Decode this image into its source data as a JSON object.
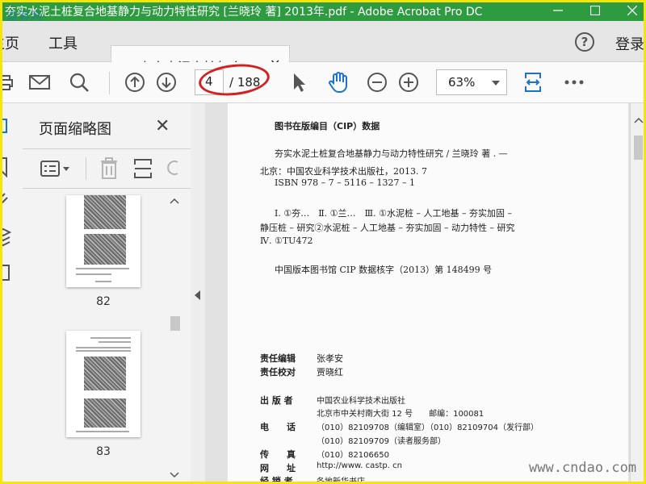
{
  "window": {
    "title": "夯实水泥土桩复合地基静力与动力特性研究 [兰晓玲 著] 2013年.pdf - Adobe Acrobat Pro DC",
    "watermark": "道客网"
  },
  "tabs": {
    "home": "主页",
    "tools": "工具",
    "document": "夯实水泥土桩复合...",
    "login": "登录"
  },
  "toolbar": {
    "current_page": "4",
    "page_total": "/ 188",
    "zoom": "63%"
  },
  "thumbnails_panel": {
    "title": "页面缩略图",
    "pages": [
      {
        "label": "82"
      },
      {
        "label": "83"
      }
    ]
  },
  "document": {
    "cip_heading": "图书在版编目（CIP）数据",
    "cip_lines": [
      "夯实水泥土桩复合地基静力与动力特性研究 / 兰晓玲 著 . —",
      "北京：中国农业科学技术出版社，2013. 7",
      "ISBN 978 – 7 – 5116 – 1327 – 1",
      "Ⅰ. ①夯…　Ⅱ. ①兰…　Ⅲ. ①水泥桩 – 人工地基 – 夯实加固 –",
      "静压桩 – 研究②水泥桩 – 人工地基 – 夯实加固 – 动力特性 – 研究",
      "Ⅳ. ①TU472",
      "中国版本图书馆 CIP 数据核字（2013）第 148499 号"
    ],
    "credits": [
      {
        "label": "责任编辑",
        "value": "张孝安"
      },
      {
        "label": "责任校对",
        "value": "贾晓红"
      }
    ],
    "publisher": [
      {
        "label": "出 版 者",
        "lines": [
          "中国农业科学技术出版社",
          "北京市中关村南大街 12 号　　邮编：100081"
        ]
      },
      {
        "label": "电　　话",
        "lines": [
          "（010）82109708（编辑室）（010）82109704（发行部）",
          "（010）82109709（读者服务部）"
        ]
      },
      {
        "label": "传　　真",
        "lines": [
          "（010）82106650"
        ]
      },
      {
        "label": "网　　址",
        "lines": [
          "http://www. castp. cn"
        ]
      },
      {
        "label": "经 销 者",
        "lines": [
          "各地新华书店"
        ]
      }
    ]
  },
  "site_watermark": "www.cndao.com",
  "colors": {
    "titlebar": "#2e9b41",
    "accent_blue": "#1a73c8",
    "annotation_red": "#d42020",
    "frame_yellow": "#f5e60a"
  }
}
